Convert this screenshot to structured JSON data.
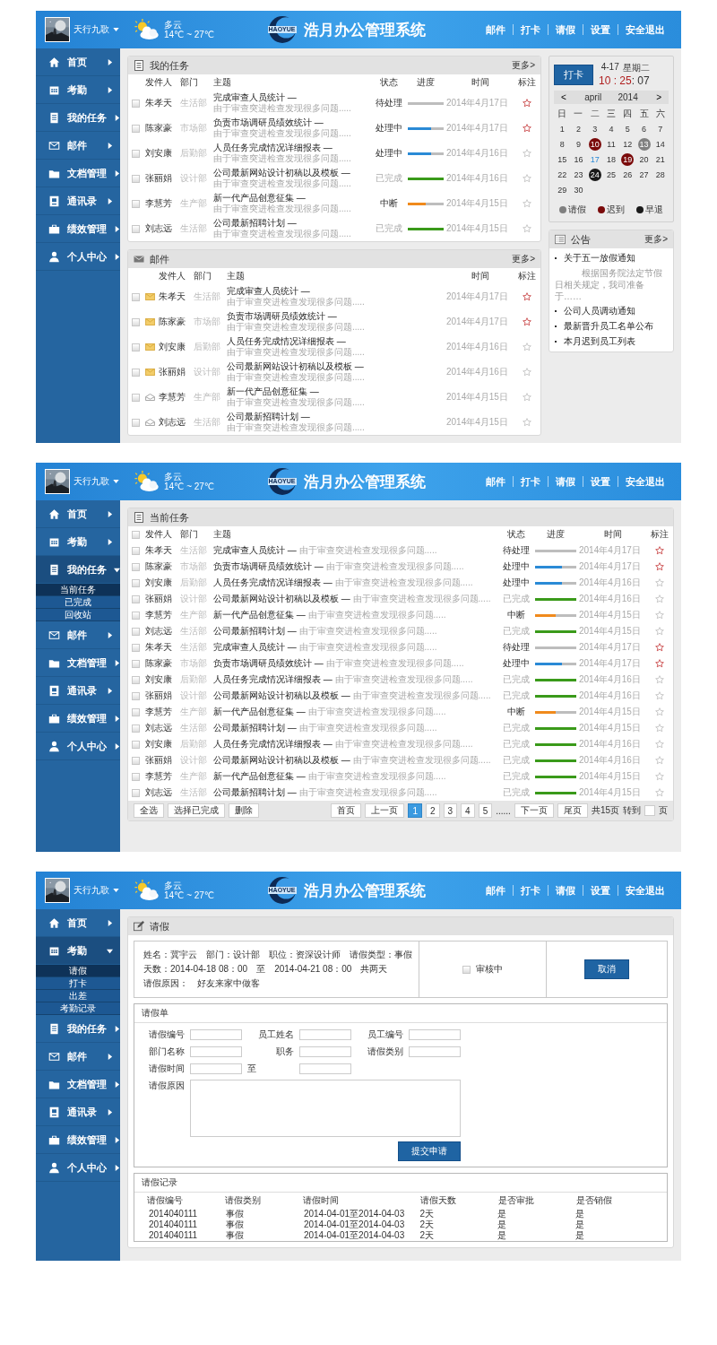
{
  "screens": [
    {
      "kind": "dashboard",
      "header": {
        "user": "天行九歌",
        "weather": {
          "condition": "多云",
          "temp": "14℃ ~ 27℃"
        },
        "logo_text": "HAOYUE",
        "title": "浩月办公管理系统",
        "nav": [
          "邮件",
          "打卡",
          "请假",
          "设置",
          "安全退出"
        ]
      },
      "sidebar": [
        {
          "label": "首页",
          "expanded": false
        },
        {
          "label": "考勤",
          "expanded": false
        },
        {
          "label": "我的任务",
          "expanded": false
        },
        {
          "label": "邮件",
          "expanded": false
        },
        {
          "label": "文档管理",
          "expanded": false
        },
        {
          "label": "通讯录",
          "expanded": false
        },
        {
          "label": "绩效管理",
          "expanded": false
        },
        {
          "label": "个人中心",
          "expanded": false
        }
      ],
      "tasks": {
        "title": "我的任务",
        "more": "更多>",
        "columns": [
          "发件人",
          "部门",
          "主题",
          "状态",
          "进度",
          "时间",
          "标注"
        ],
        "rows": [
          {
            "checked": false,
            "sender": "朱孝天",
            "dept": "生活部",
            "subject": "完成审查人员统计 —",
            "desc": "由于审查突进检查发现很多问题.....",
            "status": "待处理",
            "kind": "pending",
            "level": 0,
            "time": "2014年4月17日",
            "starred": true
          },
          {
            "checked": false,
            "sender": "陈家豪",
            "dept": "市场部",
            "subject": "负责市场调研员绩效统计 —",
            "desc": "由于审查突进检查发现很多问题.....",
            "status": "处理中",
            "kind": "active",
            "level": 0.65,
            "time": "2014年4月17日",
            "starred": true
          },
          {
            "checked": false,
            "sender": "刘安康",
            "dept": "后勤部",
            "subject": "人员任务完成情况详细报表 —",
            "desc": "由于审查突进检查发现很多问题.....",
            "status": "处理中",
            "kind": "active",
            "level": 0.65,
            "time": "2014年4月16日",
            "starred": false
          },
          {
            "checked": false,
            "sender": "张丽娟",
            "dept": "设计部",
            "subject": "公司最新网站设计初稿以及模板 —",
            "desc": "由于审查突进检查发现很多问题.....",
            "status": "已完成",
            "kind": "done",
            "level": 1,
            "time": "2014年4月16日",
            "starred": false
          },
          {
            "checked": false,
            "sender": "李慧芳",
            "dept": "生产部",
            "subject": "新一代产品创意征集 —",
            "desc": "由于审查突进检查发现很多问题.....",
            "status": "中断",
            "kind": "halted",
            "level": 0.5,
            "time": "2014年4月15日",
            "starred": false
          },
          {
            "checked": false,
            "sender": "刘志远",
            "dept": "生活部",
            "subject": "公司最新招聘计划 —",
            "desc": "由于审查突进检查发现很多问题.....",
            "status": "已完成",
            "kind": "done",
            "level": 1,
            "time": "2014年4月15日",
            "starred": false
          }
        ]
      },
      "mail": {
        "title": "邮件",
        "more": "更多>",
        "columns": [
          "发件人",
          "部门",
          "主题",
          "时间",
          "标注"
        ],
        "rows": [
          {
            "checked": false,
            "read": false,
            "sender": "朱孝天",
            "dept": "生活部",
            "subject": "完成审查人员统计 —",
            "desc": "由于审查突进检查发现很多问题.....",
            "time": "2014年4月17日",
            "starred": true
          },
          {
            "checked": false,
            "read": false,
            "sender": "陈家豪",
            "dept": "市场部",
            "subject": "负责市场调研员绩效统计 —",
            "desc": "由于审查突进检查发现很多问题.....",
            "time": "2014年4月17日",
            "starred": true
          },
          {
            "checked": false,
            "read": false,
            "sender": "刘安康",
            "dept": "后勤部",
            "subject": "人员任务完成情况详细报表 —",
            "desc": "由于审查突进检查发现很多问题.....",
            "time": "2014年4月16日",
            "starred": false
          },
          {
            "checked": false,
            "read": false,
            "sender": "张丽娟",
            "dept": "设计部",
            "subject": "公司最新网站设计初稿以及模板 —",
            "desc": "由于审查突进检查发现很多问题.....",
            "time": "2014年4月16日",
            "starred": false
          },
          {
            "checked": false,
            "read": true,
            "sender": "李慧芳",
            "dept": "生产部",
            "subject": "新一代产品创意征集 —",
            "desc": "由于审查突进检查发现很多问题.....",
            "time": "2014年4月15日",
            "starred": false
          },
          {
            "checked": false,
            "read": true,
            "sender": "刘志远",
            "dept": "生活部",
            "subject": "公司最新招聘计划 —",
            "desc": "由于审查突进检查发现很多问题.....",
            "time": "2014年4月15日",
            "starred": false
          }
        ]
      },
      "clock": {
        "button": "打卡",
        "date": "4-17",
        "weekday": "星期二",
        "hm": "10 : 25",
        "sec": ": 07"
      },
      "calendar": {
        "prev": "<",
        "month": "april",
        "year": "2014",
        "next": ">",
        "weekdays": [
          "日",
          "一",
          "二",
          "三",
          "四",
          "五",
          "六"
        ],
        "days": [
          {
            "label": "1",
            "kind": "plain"
          },
          {
            "label": "2",
            "kind": "plain"
          },
          {
            "label": "3",
            "kind": "plain"
          },
          {
            "label": "4",
            "kind": "plain"
          },
          {
            "label": "5",
            "kind": "plain"
          },
          {
            "label": "6",
            "kind": "plain"
          },
          {
            "label": "7",
            "kind": "plain"
          },
          {
            "label": "8",
            "kind": "plain"
          },
          {
            "label": "9",
            "kind": "plain"
          },
          {
            "label": "10",
            "kind": "late"
          },
          {
            "label": "11",
            "kind": "plain"
          },
          {
            "label": "12",
            "kind": "plain"
          },
          {
            "label": "13",
            "kind": "leave"
          },
          {
            "label": "14",
            "kind": "plain"
          },
          {
            "label": "15",
            "kind": "plain"
          },
          {
            "label": "16",
            "kind": "plain"
          },
          {
            "label": "17",
            "kind": "today"
          },
          {
            "label": "18",
            "kind": "plain"
          },
          {
            "label": "19",
            "kind": "late"
          },
          {
            "label": "20",
            "kind": "plain"
          },
          {
            "label": "21",
            "kind": "plain"
          },
          {
            "label": "22",
            "kind": "plain"
          },
          {
            "label": "23",
            "kind": "plain"
          },
          {
            "label": "24",
            "kind": "early"
          },
          {
            "label": "25",
            "kind": "plain"
          },
          {
            "label": "26",
            "kind": "plain"
          },
          {
            "label": "27",
            "kind": "plain"
          },
          {
            "label": "28",
            "kind": "plain"
          },
          {
            "label": "29",
            "kind": "plain"
          },
          {
            "label": "30",
            "kind": "plain"
          }
        ],
        "legend": [
          {
            "label": "请假",
            "color": "#808080"
          },
          {
            "label": "迟到",
            "color": "#7a0a0a"
          },
          {
            "label": "早退",
            "color": "#1a1a1a"
          }
        ]
      },
      "notice": {
        "title": "公告",
        "more": "更多>",
        "items": [
          {
            "text": "关于五一放假通知",
            "detail": "根据国务院法定节假日相关规定，我司准备于……"
          },
          {
            "text": "公司人员调动通知"
          },
          {
            "text": "最新晋升员工名单公布"
          },
          {
            "text": "本月迟到员工列表"
          }
        ]
      }
    },
    {
      "kind": "tasks",
      "header": {
        "user": "天行九歌",
        "weather": {
          "condition": "多云",
          "temp": "14℃ ~ 27℃"
        },
        "logo_text": "HAOYUE",
        "title": "浩月办公管理系统",
        "nav": [
          "邮件",
          "打卡",
          "请假",
          "设置",
          "安全退出"
        ]
      },
      "sidebar": [
        {
          "label": "首页",
          "expanded": false
        },
        {
          "label": "考勤",
          "expanded": false
        },
        {
          "label": "我的任务",
          "expanded": true,
          "children": [
            {
              "label": "当前任务",
              "selected": true
            },
            {
              "label": "已完成",
              "selected": false
            },
            {
              "label": "回收站",
              "selected": false
            }
          ]
        },
        {
          "label": "邮件",
          "expanded": false
        },
        {
          "label": "文档管理",
          "expanded": false
        },
        {
          "label": "通讯录",
          "expanded": false
        },
        {
          "label": "绩效管理",
          "expanded": false
        },
        {
          "label": "个人中心",
          "expanded": false
        }
      ],
      "tasks": {
        "title": "当前任务",
        "select_all_checked": false,
        "columns": [
          "发件人",
          "部门",
          "主题",
          "状态",
          "进度",
          "时间",
          "标注"
        ],
        "rows": [
          {
            "checked": false,
            "sender": "朱孝天",
            "dept": "生活部",
            "subject": "完成审查人员统计 —",
            "desc": "由于审查突进检查发现很多问题.....",
            "status": "待处理",
            "kind": "pending",
            "level": 0,
            "time": "2014年4月17日",
            "starred": true
          },
          {
            "checked": false,
            "sender": "陈家豪",
            "dept": "市场部",
            "subject": "负责市场调研员绩效统计 —",
            "desc": "由于审查突进检查发现很多问题.....",
            "status": "处理中",
            "kind": "active",
            "level": 0.65,
            "time": "2014年4月17日",
            "starred": true
          },
          {
            "checked": false,
            "sender": "刘安康",
            "dept": "后勤部",
            "subject": "人员任务完成情况详细报表 —",
            "desc": "由于审查突进检查发现很多问题.....",
            "status": "处理中",
            "kind": "active",
            "level": 0.65,
            "time": "2014年4月16日",
            "starred": false
          },
          {
            "checked": false,
            "sender": "张丽娟",
            "dept": "设计部",
            "subject": "公司最新网站设计初稿以及模板 —",
            "desc": "由于审查突进检查发现很多问题.....",
            "status": "已完成",
            "kind": "done",
            "level": 1,
            "time": "2014年4月16日",
            "starred": false
          },
          {
            "checked": false,
            "sender": "李慧芳",
            "dept": "生产部",
            "subject": "新一代产品创意征集 —",
            "desc": "由于审查突进检查发现很多问题.....",
            "status": "中断",
            "kind": "halted",
            "level": 0.5,
            "time": "2014年4月15日",
            "starred": false
          },
          {
            "checked": false,
            "sender": "刘志远",
            "dept": "生活部",
            "subject": "公司最新招聘计划 —",
            "desc": "由于审查突进检查发现很多问题.....",
            "status": "已完成",
            "kind": "done",
            "level": 1,
            "time": "2014年4月15日",
            "starred": false
          },
          {
            "checked": false,
            "sender": "朱孝天",
            "dept": "生活部",
            "subject": "完成审查人员统计 —",
            "desc": "由于审查突进检查发现很多问题.....",
            "status": "待处理",
            "kind": "pending",
            "level": 0,
            "time": "2014年4月17日",
            "starred": true
          },
          {
            "checked": false,
            "sender": "陈家豪",
            "dept": "市场部",
            "subject": "负责市场调研员绩效统计 —",
            "desc": "由于审查突进检查发现很多问题.....",
            "status": "处理中",
            "kind": "active",
            "level": 0.65,
            "time": "2014年4月17日",
            "starred": true
          },
          {
            "checked": false,
            "sender": "刘安康",
            "dept": "后勤部",
            "subject": "人员任务完成情况详细报表 —",
            "desc": "由于审查突进检查发现很多问题.....",
            "status": "已完成",
            "kind": "done",
            "level": 1,
            "time": "2014年4月16日",
            "starred": false
          },
          {
            "checked": false,
            "sender": "张丽娟",
            "dept": "设计部",
            "subject": "公司最新网站设计初稿以及模板 —",
            "desc": "由于审查突进检查发现很多问题.....",
            "status": "已完成",
            "kind": "done",
            "level": 1,
            "time": "2014年4月16日",
            "starred": false
          },
          {
            "checked": false,
            "sender": "李慧芳",
            "dept": "生产部",
            "subject": "新一代产品创意征集 —",
            "desc": "由于审查突进检查发现很多问题.....",
            "status": "中断",
            "kind": "halted",
            "level": 0.5,
            "time": "2014年4月15日",
            "starred": false
          },
          {
            "checked": false,
            "sender": "刘志远",
            "dept": "生活部",
            "subject": "公司最新招聘计划 —",
            "desc": "由于审查突进检查发现很多问题.....",
            "status": "已完成",
            "kind": "done",
            "level": 1,
            "time": "2014年4月15日",
            "starred": false
          },
          {
            "checked": false,
            "sender": "刘安康",
            "dept": "后勤部",
            "subject": "人员任务完成情况详细报表 —",
            "desc": "由于审查突进检查发现很多问题.....",
            "status": "已完成",
            "kind": "done",
            "level": 1,
            "time": "2014年4月16日",
            "starred": false
          },
          {
            "checked": false,
            "sender": "张丽娟",
            "dept": "设计部",
            "subject": "公司最新网站设计初稿以及模板 —",
            "desc": "由于审查突进检查发现很多问题.....",
            "status": "已完成",
            "kind": "done",
            "level": 1,
            "time": "2014年4月16日",
            "starred": false
          },
          {
            "checked": false,
            "sender": "李慧芳",
            "dept": "生产部",
            "subject": "新一代产品创意征集 —",
            "desc": "由于审查突进检查发现很多问题.....",
            "status": "已完成",
            "kind": "done",
            "level": 1,
            "time": "2014年4月15日",
            "starred": false
          },
          {
            "checked": false,
            "sender": "刘志远",
            "dept": "生活部",
            "subject": "公司最新招聘计划 —",
            "desc": "由于审查突进检查发现很多问题.....",
            "status": "已完成",
            "kind": "done",
            "level": 1,
            "time": "2014年4月15日",
            "starred": false
          }
        ]
      },
      "footer": {
        "actions": [
          "全选",
          "选择已完成",
          "删除"
        ],
        "pager": {
          "first": "首页",
          "prev": "上一页",
          "pages": [
            {
              "label": "1",
              "selected": true
            },
            {
              "label": "2",
              "selected": false
            },
            {
              "label": "3",
              "selected": false
            },
            {
              "label": "4",
              "selected": false
            },
            {
              "label": "5",
              "selected": false
            }
          ],
          "ellipsis": "......",
          "next": "下一页",
          "last": "尾页",
          "total": "共15页",
          "goto": "转到",
          "unit": "页"
        }
      }
    },
    {
      "kind": "leave",
      "header": {
        "user": "天行九歌",
        "weather": {
          "condition": "多云",
          "temp": "14℃ ~ 27℃"
        },
        "logo_text": "HAOYUE",
        "title": "浩月办公管理系统",
        "nav": [
          "邮件",
          "打卡",
          "请假",
          "设置",
          "安全退出"
        ]
      },
      "sidebar": [
        {
          "label": "首页",
          "expanded": false
        },
        {
          "label": "考勤",
          "expanded": true,
          "children": [
            {
              "label": "请假",
              "selected": true
            },
            {
              "label": "打卡",
              "selected": false
            },
            {
              "label": "出差",
              "selected": false
            },
            {
              "label": "考勤记录",
              "selected": false
            }
          ]
        },
        {
          "label": "我的任务",
          "expanded": false
        },
        {
          "label": "邮件",
          "expanded": false
        },
        {
          "label": "文档管理",
          "expanded": false
        },
        {
          "label": "通讯录",
          "expanded": false
        },
        {
          "label": "绩效管理",
          "expanded": false
        },
        {
          "label": "个人中心",
          "expanded": false
        }
      ],
      "leave": {
        "title": "请假",
        "summary": {
          "lines": [
            "姓名：冀宇云　部门：设计部　职位：资深设计师　请假类型：事假",
            "天数：2014-04-18 08：00　至　2014-04-21 08：00　共两天",
            "请假原因：　好友来家中做客"
          ],
          "status": {
            "label": "审核中",
            "checked": false
          },
          "cancel": "取消"
        },
        "form": {
          "title": "请假单",
          "fields": [
            {
              "label": "请假编号"
            },
            {
              "label": "员工姓名"
            },
            {
              "label": "员工编号"
            },
            {
              "label": "部门名称"
            },
            {
              "label": "职务"
            },
            {
              "label": "请假类别"
            }
          ],
          "time_label": "请假时间",
          "time_sep": "至",
          "reason_label": "请假原因",
          "submit": "提交申请"
        },
        "records": {
          "title": "请假记录",
          "columns": [
            "请假编号",
            "请假类别",
            "请假时间",
            "请假天数",
            "是否审批",
            "是否销假"
          ],
          "rows": [
            [
              "2014040111",
              "事假",
              "2014-04-01至2014-04-03",
              "2天",
              "是",
              "是"
            ],
            [
              "2014040111",
              "事假",
              "2014-04-01至2014-04-03",
              "2天",
              "是",
              "是"
            ],
            [
              "2014040111",
              "事假",
              "2014-04-01至2014-04-03",
              "2天",
              "是",
              "是"
            ]
          ]
        }
      }
    }
  ]
}
